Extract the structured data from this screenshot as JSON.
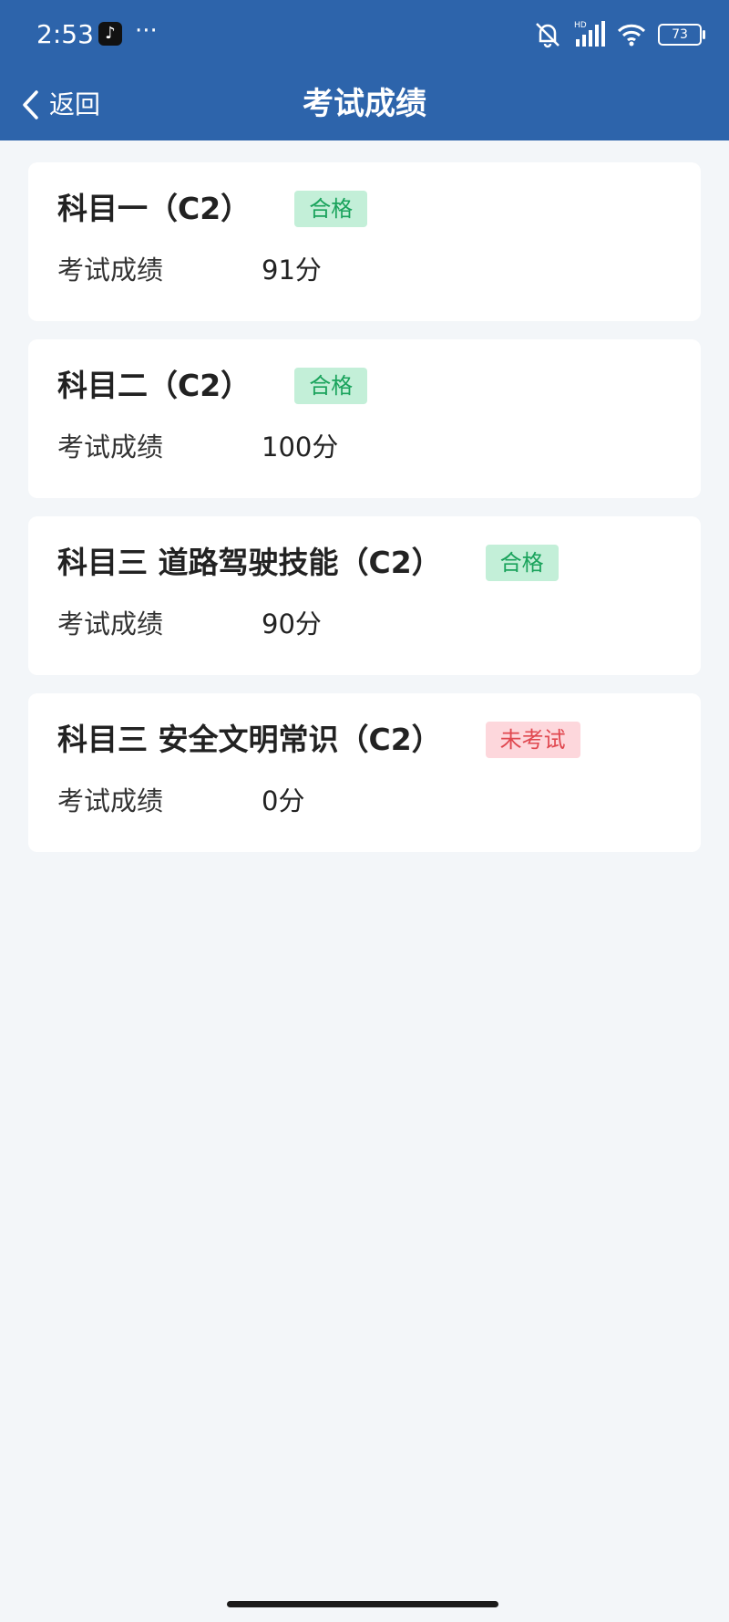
{
  "status_bar": {
    "time": "2:53",
    "more": "···",
    "battery": "73",
    "hd_label": "HD",
    "icons": [
      "tiktok-icon",
      "bell-off-icon",
      "signal-icon",
      "wifi-icon",
      "battery-icon"
    ]
  },
  "header": {
    "back_label": "返回",
    "title": "考试成绩"
  },
  "colors": {
    "header_bg": "#2d64ab",
    "page_bg": "#f3f6f9",
    "pass_bg": "#c3efd8",
    "pass_text": "#1aa35c",
    "fail_bg": "#fdd7dc",
    "fail_text": "#e0474f"
  },
  "exams": [
    {
      "subject": "科目一（C2）",
      "status": "合格",
      "status_type": "pass",
      "score_label": "考试成绩",
      "score": "91分"
    },
    {
      "subject": "科目二（C2）",
      "status": "合格",
      "status_type": "pass",
      "score_label": "考试成绩",
      "score": "100分"
    },
    {
      "subject": "科目三 道路驾驶技能（C2）",
      "status": "合格",
      "status_type": "pass",
      "score_label": "考试成绩",
      "score": "90分"
    },
    {
      "subject": "科目三 安全文明常识（C2）",
      "status": "未考试",
      "status_type": "fail",
      "score_label": "考试成绩",
      "score": "0分"
    }
  ]
}
